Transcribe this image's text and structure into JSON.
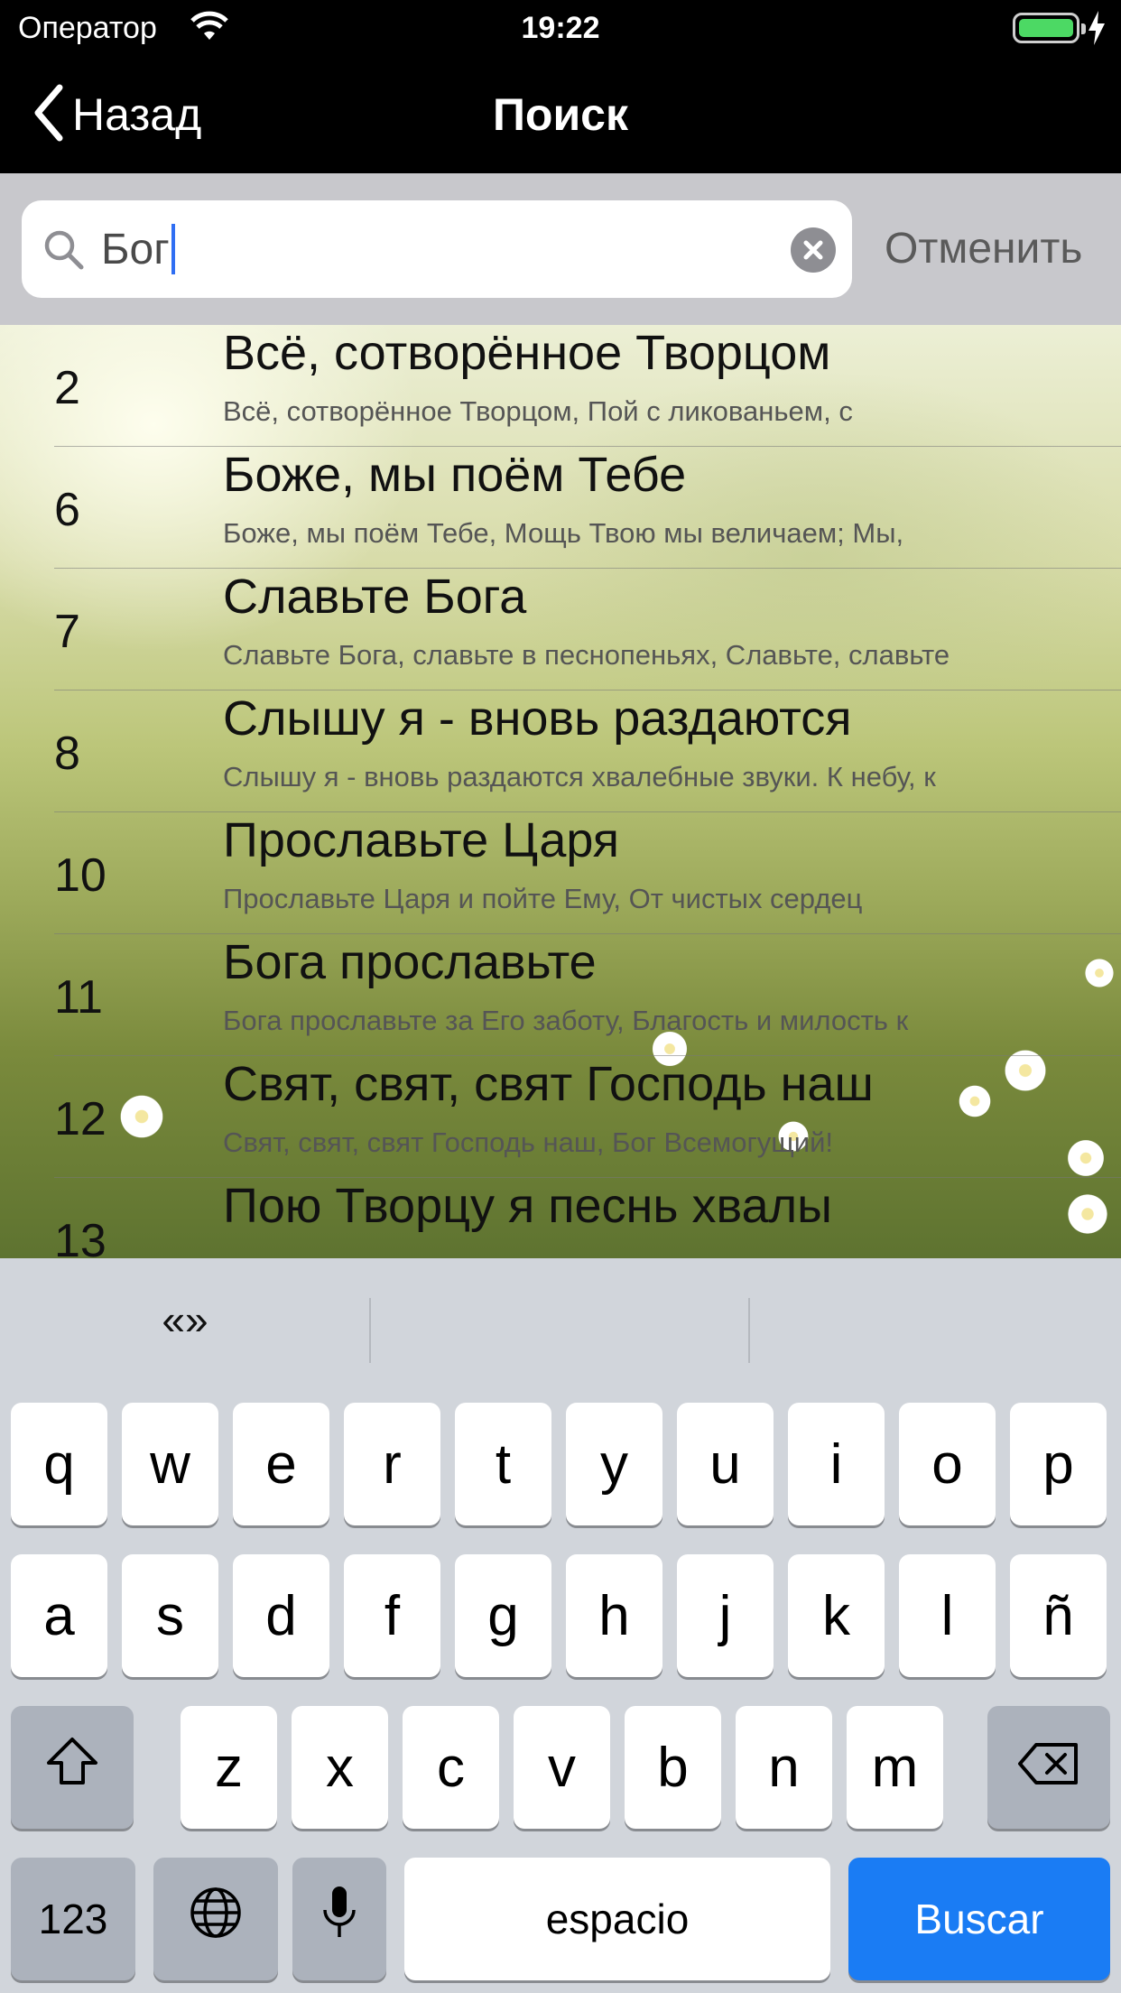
{
  "status_bar": {
    "carrier": "Оператор",
    "time": "19:22",
    "battery_level": 1.0
  },
  "nav": {
    "back_label": "Назад",
    "title": "Поиск"
  },
  "search": {
    "value": "Бог",
    "cancel_label": "Отменить"
  },
  "results": [
    {
      "number": "2",
      "title": "Всё, сотворённое Творцом",
      "snippet": "Всё, сотворённое Творцом, Пой с ликованьем, с"
    },
    {
      "number": "6",
      "title": "Боже, мы поём Тебе",
      "snippet": " Боже, мы поём Тебе, Мощь Твою мы величаем; Мы,"
    },
    {
      "number": "7",
      "title": "Славьте Бога",
      "snippet": "Славьте Бога, славьте в песнопеньях, Славьте, славьте"
    },
    {
      "number": "8",
      "title": "Слышу я - вновь раздаются",
      "snippet": "Слышу я - вновь раздаются хвалебные звуки. К небу, к"
    },
    {
      "number": "10",
      "title": "Прославьте Царя",
      "snippet": "Прославьте Царя и пойте Ему, От чистых сердец"
    },
    {
      "number": "11",
      "title": "Бога прославьте",
      "snippet": "Бога прославьте за Его заботу, Благость и милость к"
    },
    {
      "number": "12",
      "title": "Свят, свят, свят Господь наш",
      "snippet": "Свят, свят, свят Господь наш, Бог Всемогущий!"
    },
    {
      "number": "13",
      "title": "Пою Творцу я песнь хвалы",
      "snippet": ""
    }
  ],
  "keyboard": {
    "suggestions": [
      "«»",
      "",
      ""
    ],
    "row1": [
      "q",
      "w",
      "e",
      "r",
      "t",
      "y",
      "u",
      "i",
      "o",
      "p"
    ],
    "row2": [
      "a",
      "s",
      "d",
      "f",
      "g",
      "h",
      "j",
      "k",
      "l",
      "ñ"
    ],
    "row3": [
      "z",
      "x",
      "c",
      "v",
      "b",
      "n",
      "m"
    ],
    "numbers_label": "123",
    "space_label": "espacio",
    "search_label": "Buscar"
  },
  "colors": {
    "accent": "#1a7cf4",
    "battery": "#4cd964",
    "caret": "#2f6ef3"
  },
  "icons": [
    "wifi-icon",
    "battery-icon",
    "charging-bolt-icon",
    "back-chevron-icon",
    "search-icon",
    "clear-icon",
    "shift-icon",
    "backspace-icon",
    "globe-icon",
    "microphone-icon"
  ]
}
